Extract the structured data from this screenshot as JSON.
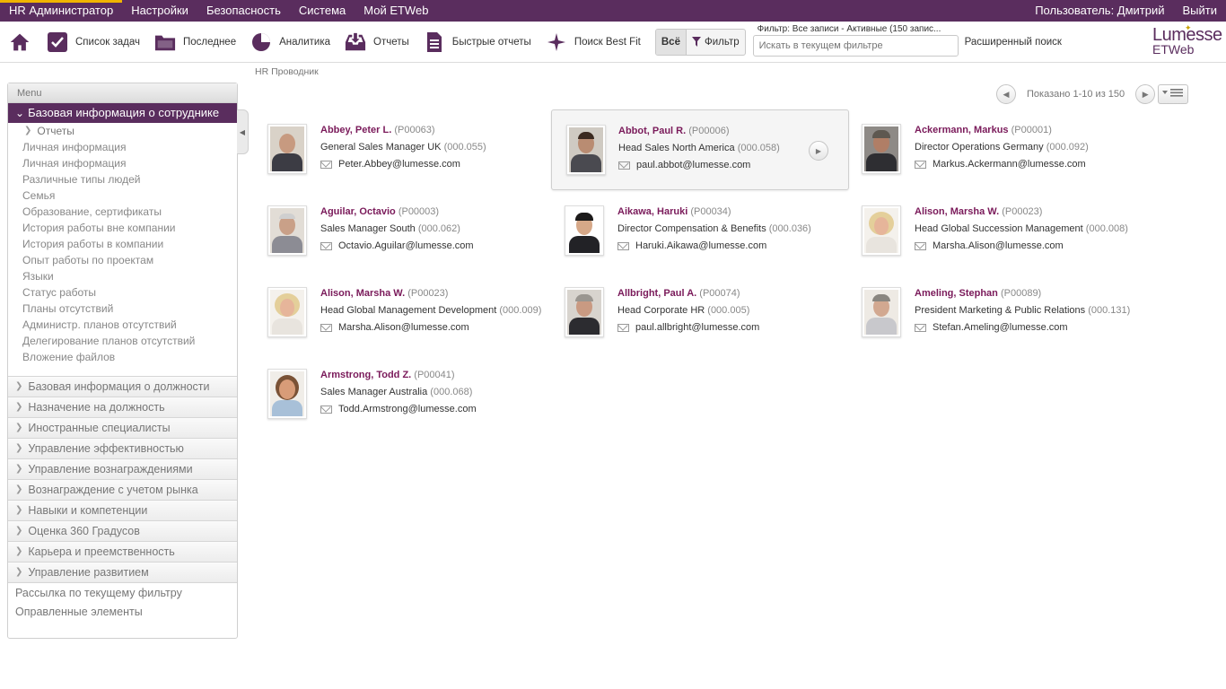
{
  "topbar": {
    "items": [
      "HR Администратор",
      "Настройки",
      "Безопасность",
      "Система",
      "Мой ETWeb"
    ],
    "user": "Пользователь: Дмитрий",
    "logout": "Выйти"
  },
  "toolbar": {
    "home_icon": "home-icon",
    "tasks": "Список задач",
    "recent": "Последнее",
    "analytics": "Аналитика",
    "reports": "Отчеты",
    "quick_reports": "Быстрые отчеты",
    "bestfit": "Поиск Best Fit",
    "seg_all": "Всё",
    "seg_filter": "Фильтр",
    "filter_text": "Фильтр: Все записи - Активные (150 запис...",
    "search_placeholder": "Искать в текущем фильтре",
    "advanced": "Расширенный поиск",
    "logo_line1": "Lumesse",
    "logo_line2": "ETWeb"
  },
  "breadcrumb": "HR Проводник",
  "sidebar": {
    "header": "Menu",
    "active": "Базовая информация о сотруднике",
    "sub": "Отчеты",
    "links": [
      "Личная информация",
      "Личная информация",
      "Различные типы людей",
      "Семья",
      "Образование, сертификаты",
      "История работы вне компании",
      "История работы в компании",
      "Опыт работы по проектам",
      "Языки",
      "Статус работы",
      "Планы отсутствий",
      "Администр. планов отсутствий",
      "Делегирование планов отсутствий",
      "Вложение файлов"
    ],
    "sections": [
      "Базовая информация о должности",
      "Назначение на должность",
      "Иностранные специалисты",
      "Управление эффективностью",
      "Управление вознаграждениями",
      "Вознаграждение с учетом рынка",
      "Навыки и компетенции",
      "Оценка 360 Градусов",
      "Карьера и преемственность",
      "Управление развитием"
    ],
    "plain": [
      "Рассылка по текущему фильтру",
      "Оправленные элементы"
    ]
  },
  "pager": {
    "text": "Показано 1-10 из 150"
  },
  "people": [
    {
      "name": "Abbey, Peter L.",
      "pid": "(P00063)",
      "role": "General Sales Manager UK",
      "code": "(000.055)",
      "email": "Peter.Abbey@lumesse.com"
    },
    {
      "name": "Abbot, Paul R.",
      "pid": "(P00006)",
      "role": "Head Sales North America",
      "code": "(000.058)",
      "email": "paul.abbot@lumesse.com"
    },
    {
      "name": "Ackermann, Markus",
      "pid": "(P00001)",
      "role": "Director Operations Germany",
      "code": "(000.092)",
      "email": "Markus.Ackermann@lumesse.com"
    },
    {
      "name": "Aguilar, Octavio",
      "pid": "(P00003)",
      "role": "Sales Manager South",
      "code": "(000.062)",
      "email": "Octavio.Aguilar@lumesse.com"
    },
    {
      "name": "Aikawa, Haruki",
      "pid": "(P00034)",
      "role": "Director Compensation & Benefits",
      "code": "(000.036)",
      "email": "Haruki.Aikawa@lumesse.com"
    },
    {
      "name": "Alison, Marsha W.",
      "pid": "(P00023)",
      "role": "Head Global Succession Management",
      "code": "(000.008)",
      "email": "Marsha.Alison@lumesse.com"
    },
    {
      "name": "Alison, Marsha W.",
      "pid": "(P00023)",
      "role": "Head Global Management Development",
      "code": "(000.009)",
      "email": "Marsha.Alison@lumesse.com"
    },
    {
      "name": "Allbright, Paul A.",
      "pid": "(P00074)",
      "role": "Head Corporate HR",
      "code": "(000.005)",
      "email": "paul.allbright@lumesse.com"
    },
    {
      "name": "Ameling, Stephan",
      "pid": "(P00089)",
      "role": "President Marketing & Public Relations",
      "code": "(000.131)",
      "email": "Stefan.Ameling@lumesse.com"
    },
    {
      "name": "Armstrong, Todd Z.",
      "pid": "(P00041)",
      "role": "Sales Manager Australia",
      "code": "(000.068)",
      "email": "Todd.Armstrong@lumesse.com"
    }
  ],
  "colors": {
    "brand": "#5a2d5e",
    "name": "#7a1a5a",
    "accent": "#f0b400"
  }
}
